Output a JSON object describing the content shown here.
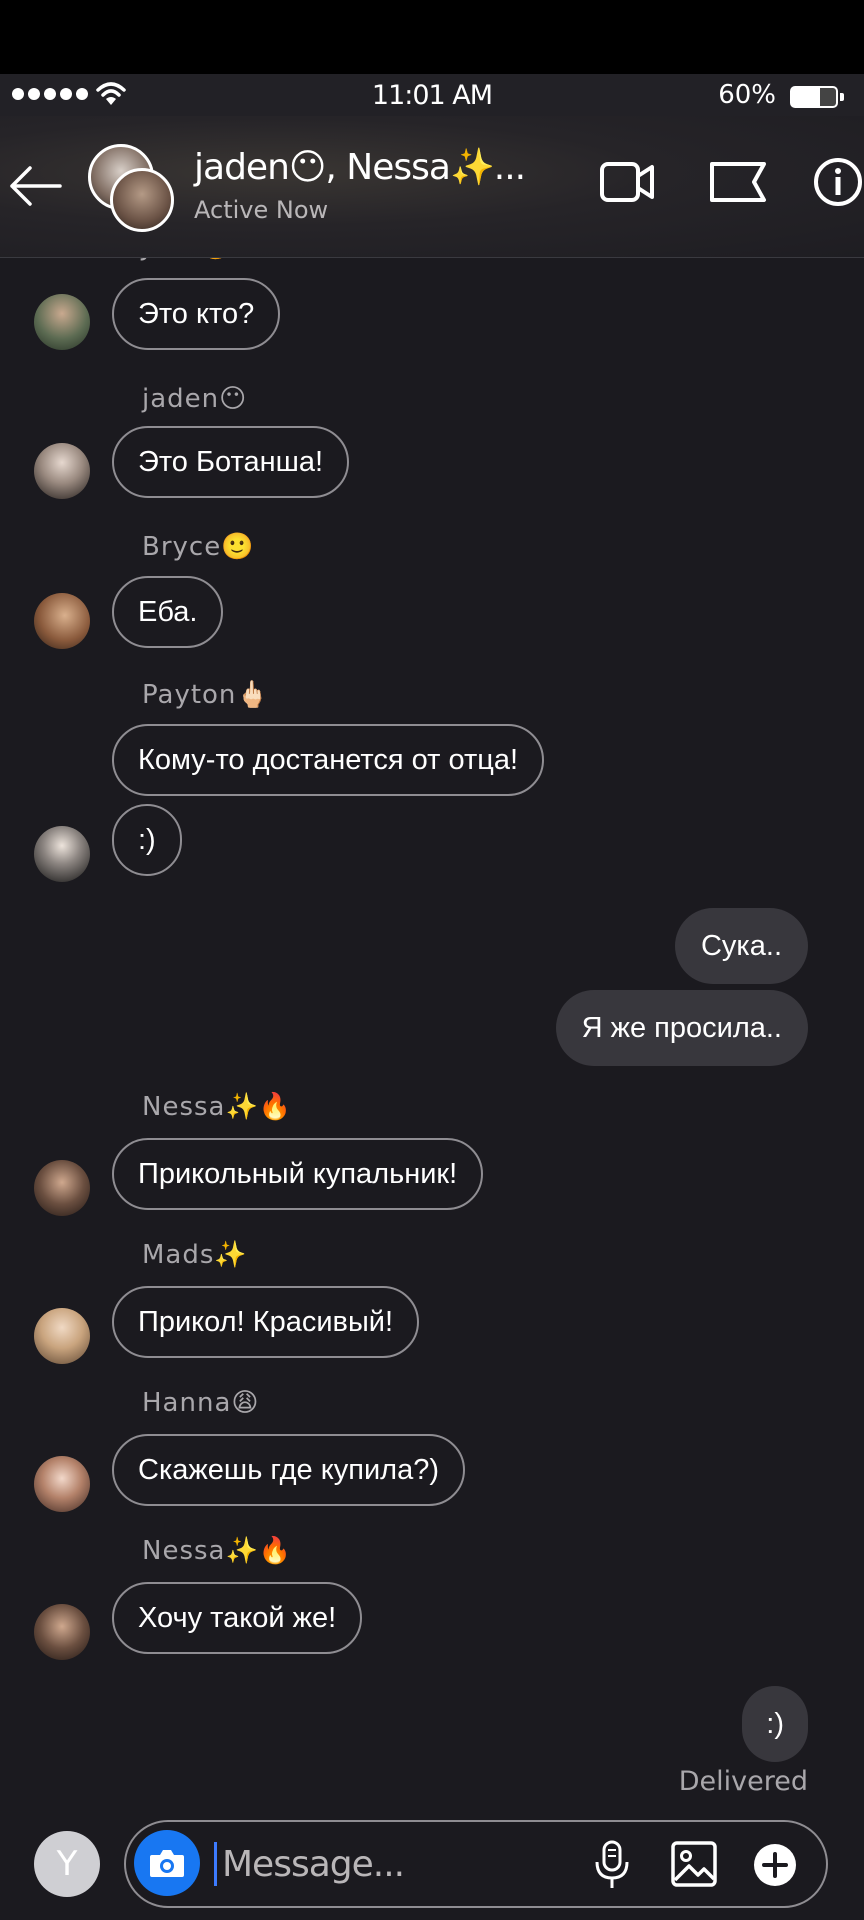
{
  "status_bar": {
    "time": "11:01 AM",
    "battery": "60%"
  },
  "header": {
    "back_icon": "arrow-left-icon",
    "title": "jaden😶, Nessa✨...",
    "subtitle": "Active Now",
    "icons": [
      "video-camera-icon",
      "flag-icon",
      "info-icon"
    ]
  },
  "messages": [
    {
      "sender": "",
      "text": "Это кто?"
    },
    {
      "sender": "jaden😶",
      "text": "Это Ботанша!"
    },
    {
      "sender": "Bryce🙂",
      "text": "Еба."
    },
    {
      "sender": "Payton🖕🏻",
      "text": "Кому-то достанется от отца!"
    },
    {
      "sender": "",
      "text": ":)"
    },
    {
      "sender": "me",
      "text": "Сука.."
    },
    {
      "sender": "me",
      "text": "Я же просила.."
    },
    {
      "sender": "Nessa✨🔥",
      "text": "Прикольный купальник!"
    },
    {
      "sender": "Mads✨",
      "text": "Прикол! Красивый!"
    },
    {
      "sender": "Hanna😩",
      "text": "Скажешь где купила?)"
    },
    {
      "sender": "Nessa✨🔥",
      "text": "Хочу такой же!"
    },
    {
      "sender": "me",
      "text": ":)"
    }
  ],
  "delivered_label": "Delivered",
  "composer": {
    "avatar_letter": "Y",
    "placeholder": "Message...",
    "icons": [
      "camera-icon",
      "microphone-icon",
      "image-icon",
      "plus-icon"
    ]
  },
  "colors": {
    "background": "#1b1a1f",
    "outgoing_bubble": "#38373d",
    "camera_button": "#1877f2"
  }
}
